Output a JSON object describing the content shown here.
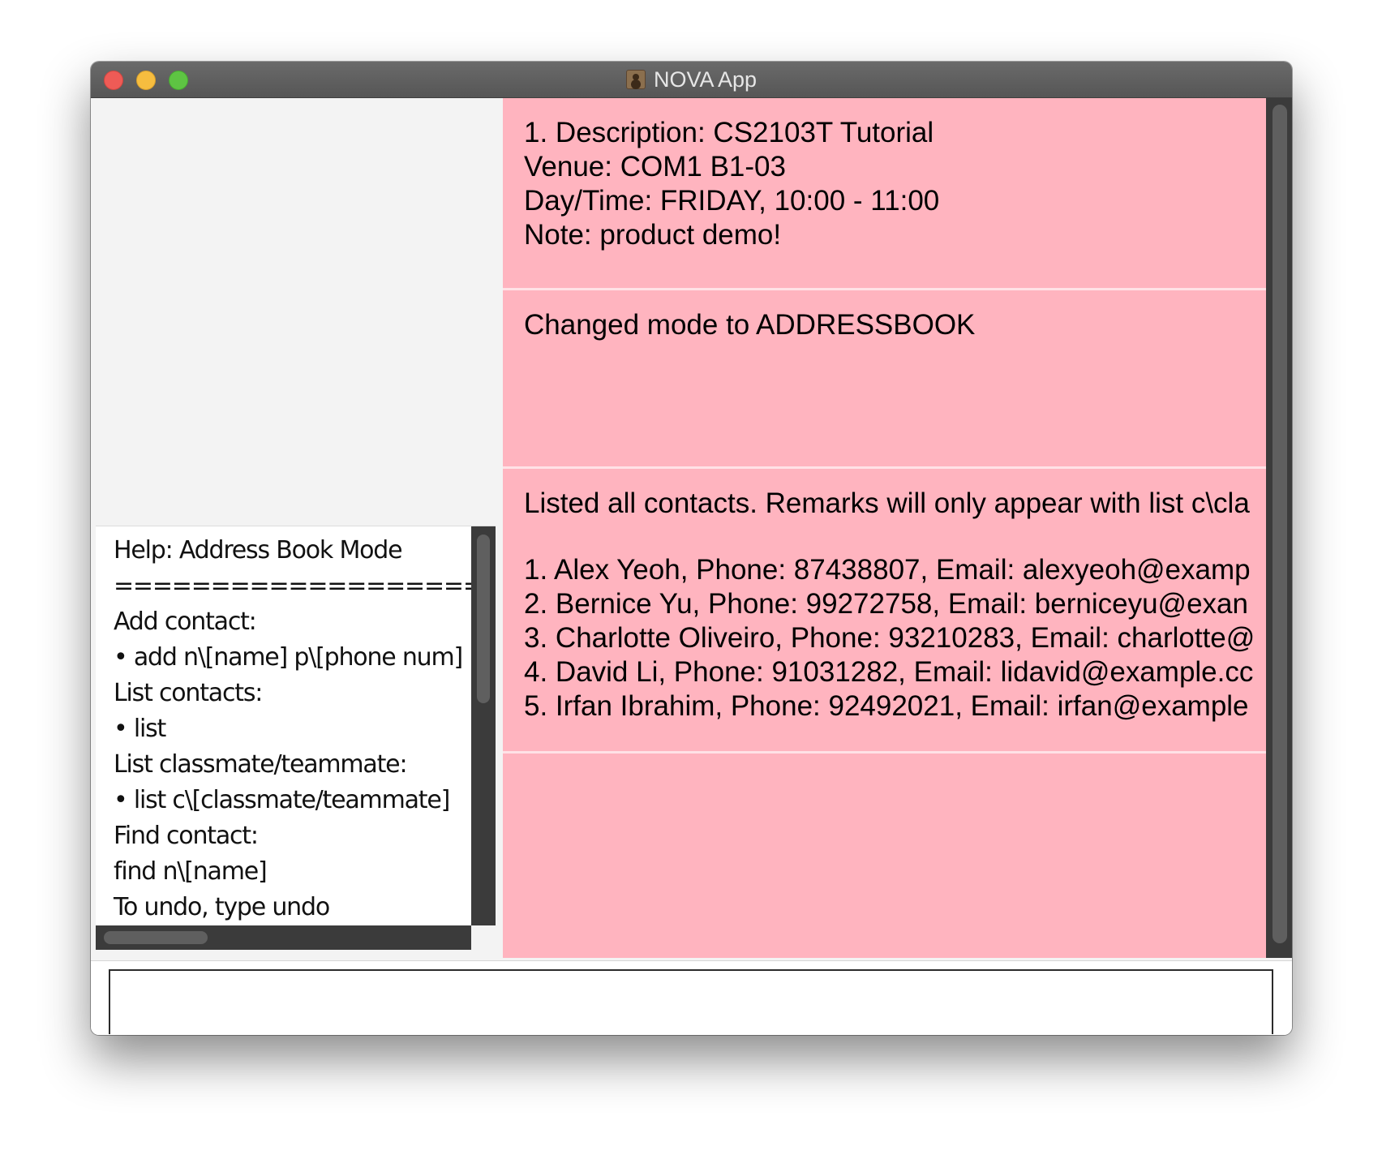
{
  "window": {
    "title": "NOVA App",
    "app_icon": "contacts-app-icon",
    "traffic_lights": {
      "close": "#ee5b56",
      "minimize": "#f6bd3f",
      "maximize": "#5ec443"
    }
  },
  "help": {
    "lines": [
      "Help: Address Book Mode",
      "===================",
      "Add contact:",
      "• add n\\[name] p\\[phone num]",
      "List contacts:",
      "• list",
      "List classmate/teammate:",
      "• list c\\[classmate/teammate]",
      "Find contact:",
      "find n\\[name]",
      "To undo, type undo"
    ]
  },
  "results": {
    "accent_color": "#ffb4bf",
    "cards": [
      {
        "lines": [
          "1. Description: CS2103T Tutorial",
          "Venue: COM1 B1-03",
          "Day/Time: FRIDAY, 10:00 - 11:00",
          "Note: product demo!"
        ]
      },
      {
        "lines": [
          "Changed mode to ADDRESSBOOK"
        ]
      },
      {
        "message": "Listed all contacts. Remarks will only appear with list c\\cla",
        "contacts": [
          "1. Alex Yeoh, Phone: 87438807, Email: alexyeoh@examp",
          "2. Bernice Yu, Phone: 99272758, Email: berniceyu@exan",
          "3. Charlotte Oliveiro, Phone: 93210283, Email: charlotte@",
          "4. David Li, Phone: 91031282, Email: lidavid@example.cc",
          "5. Irfan Ibrahim, Phone: 92492021, Email: irfan@example"
        ]
      },
      {
        "lines": []
      }
    ]
  },
  "command": {
    "value": "",
    "placeholder": ""
  }
}
